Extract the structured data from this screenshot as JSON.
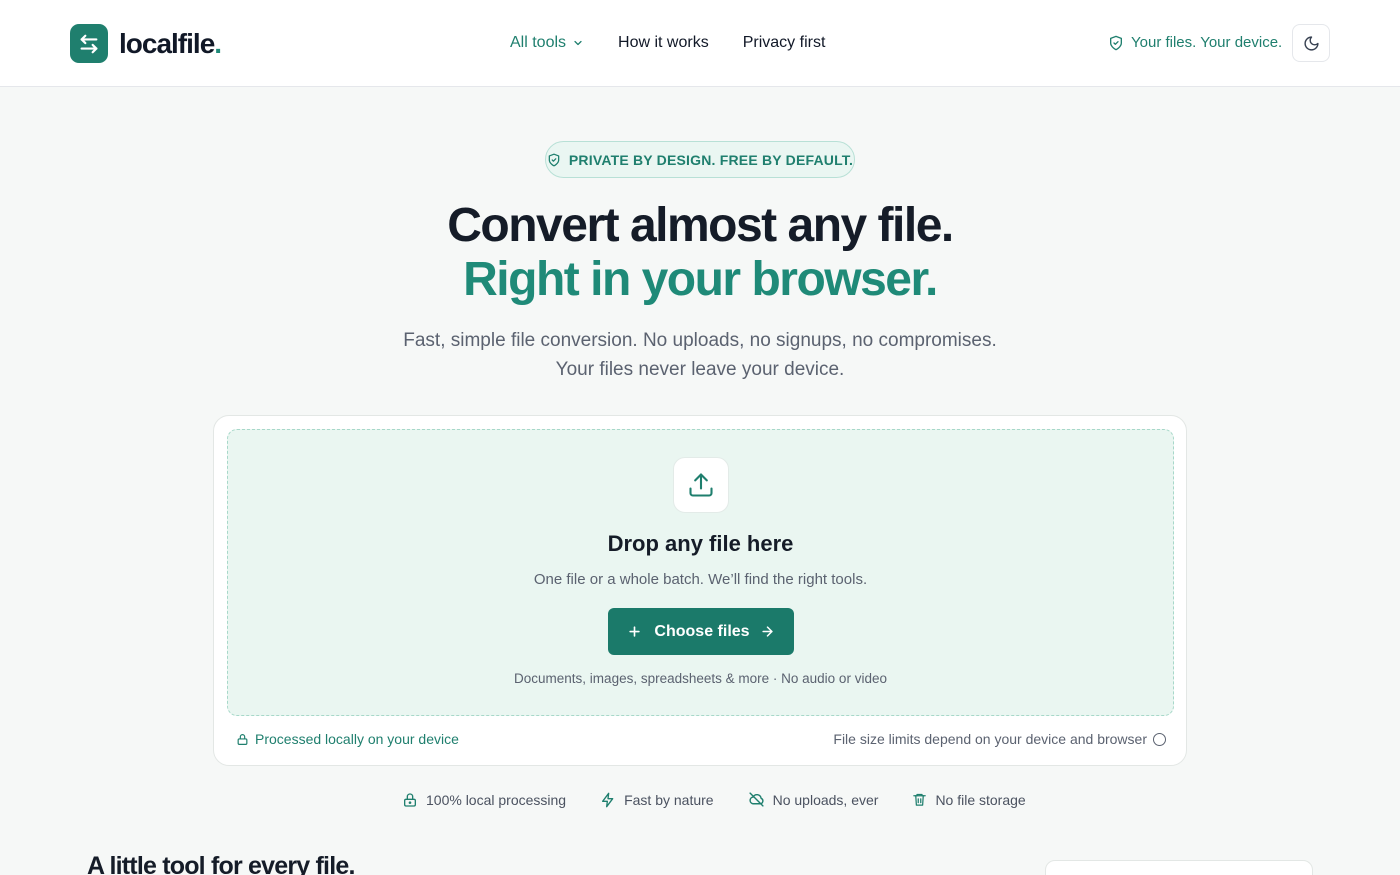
{
  "header": {
    "logo_text": "localfile",
    "logo_dot": ".",
    "nav": [
      {
        "label": "All tools"
      },
      {
        "label": "How it works"
      },
      {
        "label": "Privacy first"
      }
    ],
    "trust_text": "Your files. Your device."
  },
  "hero": {
    "badge": "PRIVATE BY DESIGN. FREE BY DEFAULT.",
    "title_line1": "Convert almost any file.",
    "title_line2": "Right in your browser.",
    "subtitle_line1": "Fast, simple file conversion. No uploads, no signups, no compromises.",
    "subtitle_line2": "Your files never leave your device."
  },
  "dropzone": {
    "title": "Drop any file here",
    "subtitle": "One file or a whole batch. We’ll find the right tools.",
    "button_label": "Choose files",
    "note": "Documents, images, spreadsheets & more · No audio or video"
  },
  "card_footer": {
    "left": "Processed locally on your device",
    "right": "File size limits depend on your device and browser"
  },
  "features": [
    {
      "label": "100% local processing"
    },
    {
      "label": "Fast by nature"
    },
    {
      "label": "No uploads, ever"
    },
    {
      "label": "No file storage"
    }
  ],
  "section": {
    "title": "A little tool for every file."
  },
  "colors": {
    "accent": "#1f7f6e",
    "accent_light": "#eaf6f1",
    "text": "#151c28",
    "muted": "#5b6270"
  }
}
